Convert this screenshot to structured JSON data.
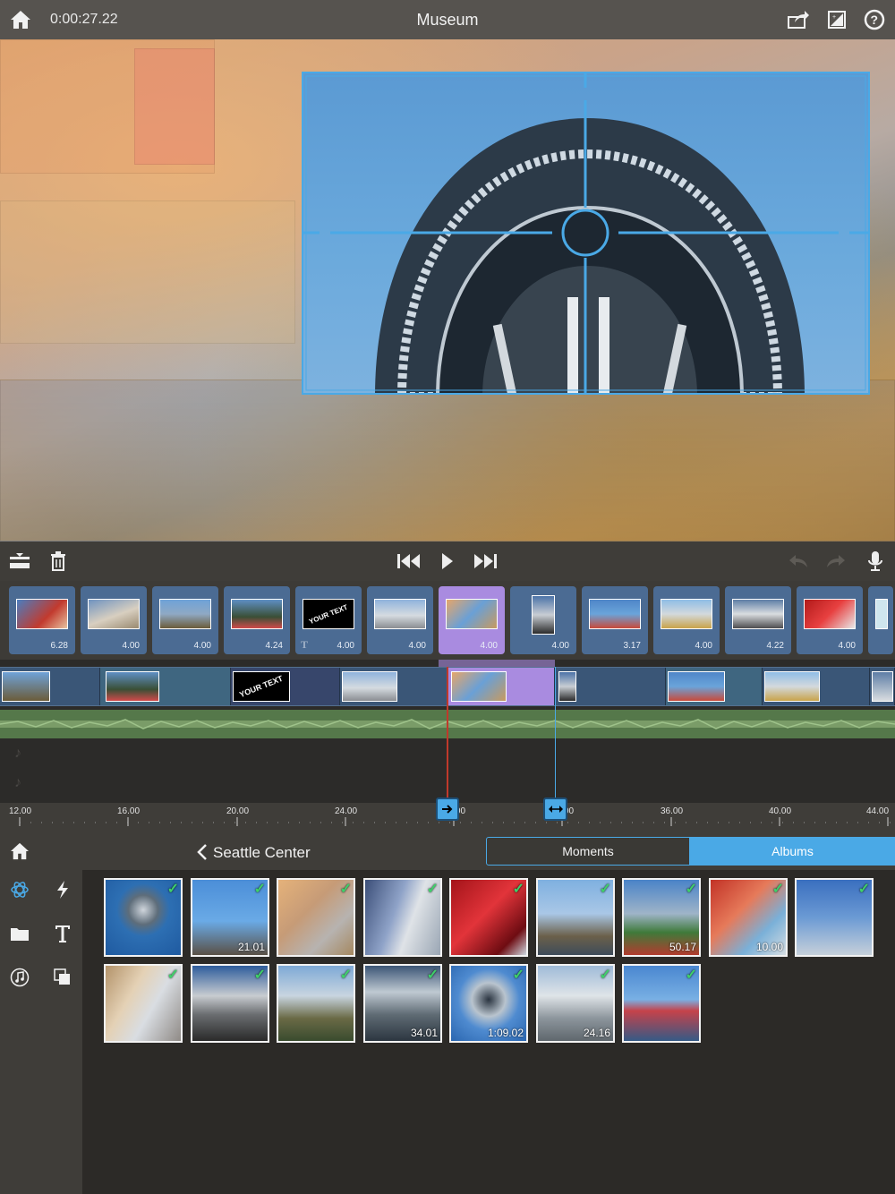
{
  "header": {
    "timecode": "0:00:27.22",
    "project_title": "Museum",
    "icons": [
      "home-icon",
      "share-icon",
      "project-settings-icon",
      "help-icon"
    ]
  },
  "toolbar": {
    "icons": [
      "split-icon",
      "trash-icon",
      "skip-back-icon",
      "play-icon",
      "skip-forward-icon",
      "undo-icon",
      "redo-icon",
      "microphone-icon"
    ]
  },
  "clip_strip": {
    "clips": [
      {
        "duration": "6.28",
        "selected": false
      },
      {
        "duration": "4.00",
        "selected": false
      },
      {
        "duration": "4.00",
        "selected": false
      },
      {
        "duration": "4.24",
        "selected": false
      },
      {
        "duration": "4.00",
        "selected": false,
        "title_clip": true,
        "text_marker": "T",
        "thumb_text": "YOUR TEXT"
      },
      {
        "duration": "4.00",
        "selected": false
      },
      {
        "duration": "4.00",
        "selected": true
      },
      {
        "duration": "4.00",
        "selected": false
      },
      {
        "duration": "3.17",
        "selected": false
      },
      {
        "duration": "4.00",
        "selected": false
      },
      {
        "duration": "4.22",
        "selected": false
      },
      {
        "duration": "4.00",
        "selected": false
      }
    ]
  },
  "timeline": {
    "title_thumb_text": "YOUR TEXT",
    "ruler_labels": [
      "12.00",
      "16.00",
      "20.00",
      "24.00",
      "28.00",
      "32.00",
      "36.00",
      "40.00",
      "44.00"
    ]
  },
  "library": {
    "back_label": "Seattle Center",
    "tabs": [
      {
        "label": "Moments",
        "active": false
      },
      {
        "label": "Albums",
        "active": true
      }
    ],
    "side_icons": [
      "home-icon",
      "media-icon",
      "transitions-icon",
      "folder-icon",
      "titles-icon",
      "music-icon",
      "overlay-icon"
    ],
    "rows": [
      [
        {
          "duration": ""
        },
        {
          "duration": "21.01"
        },
        {
          "duration": ""
        },
        {
          "duration": ""
        },
        {
          "duration": ""
        },
        {
          "duration": ""
        },
        {
          "duration": "50.17"
        },
        {
          "duration": "10.00"
        },
        {
          "duration": ""
        }
      ],
      [
        {
          "duration": ""
        },
        {
          "duration": ""
        },
        {
          "duration": ""
        },
        {
          "duration": "34.01"
        },
        {
          "duration": "1:09.02"
        },
        {
          "duration": "24.16"
        },
        {
          "duration": ""
        }
      ]
    ]
  },
  "colors": {
    "accent_blue": "#4aa9e6",
    "selected_clip": "#a98be0",
    "check_green": "#3fd06a"
  }
}
